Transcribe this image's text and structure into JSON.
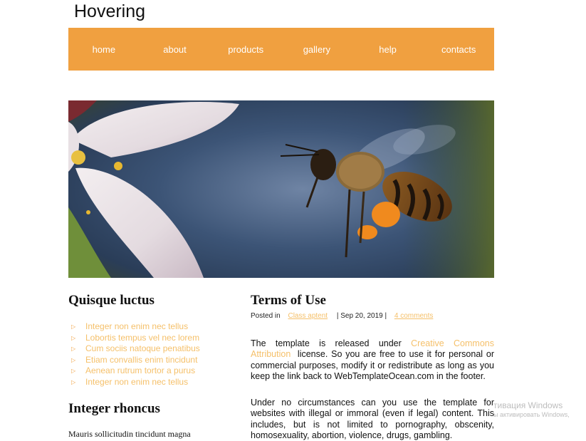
{
  "site": {
    "title": "Hovering"
  },
  "nav": {
    "items": [
      {
        "label": "home"
      },
      {
        "label": "about"
      },
      {
        "label": "products"
      },
      {
        "label": "gallery"
      },
      {
        "label": "help"
      },
      {
        "label": "contacts"
      }
    ],
    "color": "#f0a040"
  },
  "sidebar": {
    "heading1": "Quisque luctus",
    "links": [
      "Integer non enim nec tellus",
      "Lobortis tempus vel nec lorem",
      "Cum sociis natoque penatibus",
      "Etiam convallis enim tincidunt",
      "Aenean rutrum tortor a purus",
      "Integer non enim nec tellus"
    ],
    "heading2": "Integer rhoncus",
    "para": "Mauris sollicitudin tincidunt magna"
  },
  "article": {
    "title": "Terms of Use",
    "meta": {
      "posted_in": "Posted in",
      "category": "Class aptent",
      "date": "| Sep 20, 2019 |",
      "comments": "4 comments"
    },
    "p1_pre": "The template is released under",
    "p1_link": "Creative Commons Attribution",
    "p1_post": "license. So you are free to use it for personal or commercial purposes, modify it or redistribute as long as you keep the link back to WebTemplateOcean.com in the footer.",
    "p2": "Under no circumstances can you use the template for websites with illegal or immoral (even if legal) content. This includes, but is not limited to pornography, obscenity, homosexuality, abortion, violence, drugs, gambling."
  },
  "watermark": {
    "line1": "тивация Windows",
    "line2": "ы активировать Windows,"
  },
  "colors": {
    "accent": "#f0a040",
    "link": "#f5c06a"
  }
}
